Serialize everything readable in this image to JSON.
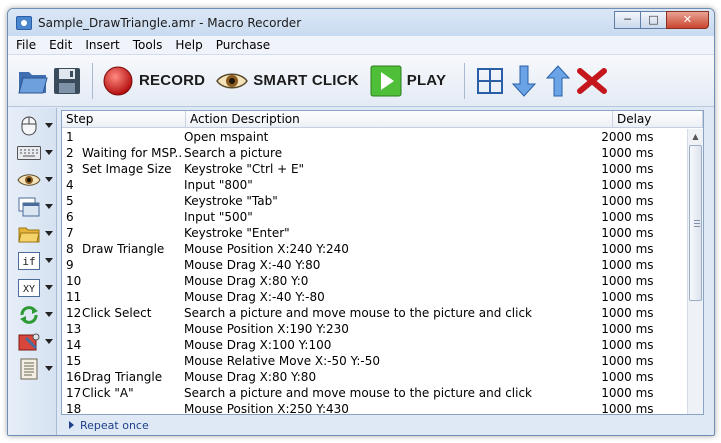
{
  "window": {
    "title": "Sample_DrawTriangle.amr - Macro Recorder"
  },
  "menu": [
    "File",
    "Edit",
    "Insert",
    "Tools",
    "Help",
    "Purchase"
  ],
  "toolbar": {
    "record": "RECORD",
    "smart_click": "SMART CLICK",
    "play": "PLAY"
  },
  "sidebar": [
    {
      "icon": "mouse-icon"
    },
    {
      "icon": "keyboard-icon"
    },
    {
      "icon": "eye-icon"
    },
    {
      "icon": "window-icon"
    },
    {
      "icon": "folder-icon"
    },
    {
      "icon": "if-icon",
      "text": "if"
    },
    {
      "icon": "xy-icon",
      "text": "XY"
    },
    {
      "icon": "loop-icon"
    },
    {
      "icon": "tools-icon"
    },
    {
      "icon": "script-icon"
    }
  ],
  "grid": {
    "headers": {
      "step": "Step",
      "action": "Action Description",
      "delay": "Delay"
    },
    "rows": [
      {
        "num": "1",
        "label": "",
        "action": "Open mspaint",
        "delay": "2000 ms"
      },
      {
        "num": "2",
        "label": "Waiting for MSP...",
        "action": "Search a picture",
        "delay": "1000 ms"
      },
      {
        "num": "3",
        "label": "Set Image Size",
        "action": "Keystroke \"Ctrl + E\"",
        "delay": "1000 ms"
      },
      {
        "num": "4",
        "label": "",
        "action": "Input \"800\"",
        "delay": "1000 ms"
      },
      {
        "num": "5",
        "label": "",
        "action": "Keystroke \"Tab\"",
        "delay": "1000 ms"
      },
      {
        "num": "6",
        "label": "",
        "action": "Input \"500\"",
        "delay": "1000 ms"
      },
      {
        "num": "7",
        "label": "",
        "action": "Keystroke \"Enter\"",
        "delay": "1000 ms"
      },
      {
        "num": "8",
        "label": "Draw Triangle",
        "action": "Mouse Position X:240 Y:240",
        "delay": "1000 ms"
      },
      {
        "num": "9",
        "label": "",
        "action": "Mouse Drag X:-40 Y:80",
        "delay": "1000 ms"
      },
      {
        "num": "10",
        "label": "",
        "action": "Mouse Drag X:80 Y:0",
        "delay": "1000 ms"
      },
      {
        "num": "11",
        "label": "",
        "action": "Mouse Drag X:-40 Y:-80",
        "delay": "1000 ms"
      },
      {
        "num": "12",
        "label": "Click Select",
        "action": "Search a picture and move mouse to the picture and click",
        "delay": "1000 ms"
      },
      {
        "num": "13",
        "label": "",
        "action": "Mouse Position X:190 Y:230",
        "delay": "1000 ms"
      },
      {
        "num": "14",
        "label": "",
        "action": "Mouse Drag X:100 Y:100",
        "delay": "1000 ms"
      },
      {
        "num": "15",
        "label": "",
        "action": "Mouse Relative Move X:-50 Y:-50",
        "delay": "1000 ms"
      },
      {
        "num": "16",
        "label": "Drag Triangle",
        "action": "Mouse Drag X:80 Y:80",
        "delay": "1000 ms"
      },
      {
        "num": "17",
        "label": "Click \"A\"",
        "action": "Search a picture and move mouse to the picture and click",
        "delay": "1000 ms"
      },
      {
        "num": "18",
        "label": "",
        "action": "Mouse Position X:250 Y:430",
        "delay": "1000 ms"
      }
    ]
  },
  "footer": {
    "repeat": "Repeat once"
  }
}
